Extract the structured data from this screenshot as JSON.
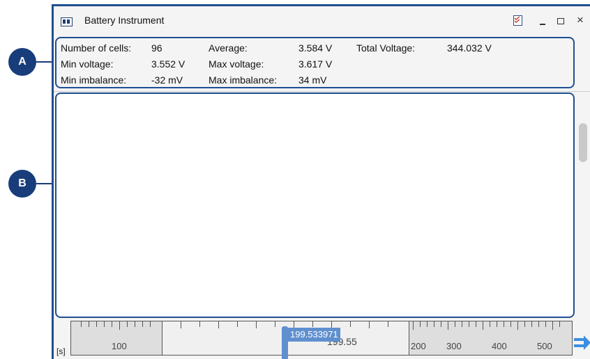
{
  "window": {
    "title": "Battery Instrument"
  },
  "callouts": {
    "a": "A",
    "b": "B"
  },
  "stats": {
    "cells_label": "Number of cells:",
    "cells_value": "96",
    "min_voltage_label": "Min voltage:",
    "min_voltage_value": "3.552 V",
    "min_imbalance_label": "Min imbalance:",
    "min_imbalance_value": "-32 mV",
    "average_label": "Average:",
    "average_value": "3.584 V",
    "max_voltage_label": "Max voltage:",
    "max_voltage_value": "3.617 V",
    "max_imbalance_label": "Max imbalance:",
    "max_imbalance_value": "34 mV",
    "total_voltage_label": "Total Voltage:",
    "total_voltage_value": "344.032 V"
  },
  "timeline": {
    "units": "[s]",
    "left_label": "100",
    "center_value": "199.55",
    "cursor_value": "199.533971",
    "right_labels": [
      "200",
      "300",
      "400",
      "500"
    ]
  },
  "colors": {
    "frame": "#1f4e91",
    "callout": "#183d7a",
    "cursor": "#5f8fcf"
  },
  "icons": {
    "app": "battery-icon",
    "pin": "pin-icon",
    "minimize": "minimize-icon",
    "maximize": "maximize-icon",
    "close": "close-icon",
    "timeline_arrow": "double-arrow-right-icon"
  }
}
